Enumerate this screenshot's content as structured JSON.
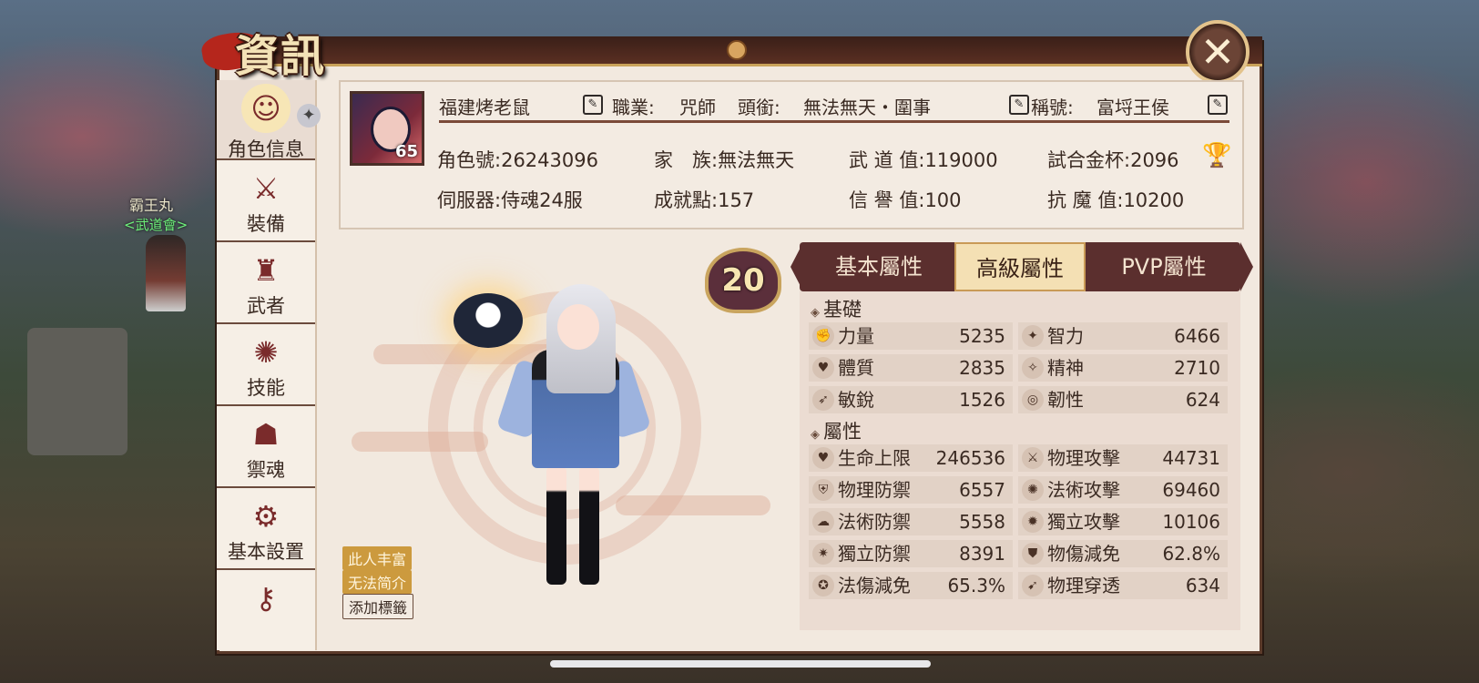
{
  "window": {
    "title": "資訊",
    "close_label": "✕"
  },
  "world": {
    "npc_name": "霸王丸",
    "npc_guild": "<武道會>"
  },
  "sidebar": {
    "items": [
      {
        "label": "角色信息",
        "icon": "character-info-icon",
        "glyph": "☺",
        "active": true
      },
      {
        "label": "裝備",
        "icon": "equipment-swords-icon",
        "glyph": "⚔"
      },
      {
        "label": "武者",
        "icon": "samurai-helmet-icon",
        "glyph": "♜"
      },
      {
        "label": "技能",
        "icon": "skill-swirl-icon",
        "glyph": "✺"
      },
      {
        "label": "禦魂",
        "icon": "soul-mask-icon",
        "glyph": "☗"
      },
      {
        "label": "基本設置",
        "icon": "gear-icon",
        "glyph": "⚙"
      },
      {
        "label": "",
        "icon": "key-icon",
        "glyph": "⚷"
      }
    ]
  },
  "profile": {
    "avatar_level": "65",
    "name": "福建烤老鼠",
    "class_label": "職業:",
    "class_value": "咒師",
    "rank_label": "頭銜:",
    "rank_value": "無法無天・圍事",
    "title_label": "稱號:",
    "title_value": "富埒王侯",
    "stats": [
      {
        "label": "角色號:",
        "value": "26243096"
      },
      {
        "label": "家　族:",
        "value": "無法無天"
      },
      {
        "label": "武 道 值:",
        "value": "119000"
      },
      {
        "label": "試合金杯:",
        "value": "2096"
      },
      {
        "label": "伺服器:",
        "value": "侍魂24服"
      },
      {
        "label": "成就點:",
        "value": "157"
      },
      {
        "label": "信 譽 值:",
        "value": "100"
      },
      {
        "label": "抗 魔 值:",
        "value": "10200"
      }
    ]
  },
  "character": {
    "badge_level": "20",
    "tags": [
      "此人丰富",
      "无法简介"
    ],
    "add_tag_label": "添加標籤"
  },
  "attributes": {
    "tabs": [
      "基本屬性",
      "高級屬性",
      "PVP屬性"
    ],
    "active_tab": 1,
    "sections": [
      {
        "title": "基礎",
        "rows": [
          [
            {
              "label": "力量",
              "value": "5235"
            },
            {
              "label": "智力",
              "value": "6466"
            }
          ],
          [
            {
              "label": "體質",
              "value": "2835"
            },
            {
              "label": "精神",
              "value": "2710"
            }
          ],
          [
            {
              "label": "敏銳",
              "value": "1526"
            },
            {
              "label": "韌性",
              "value": "624"
            }
          ]
        ]
      },
      {
        "title": "屬性",
        "rows": [
          [
            {
              "label": "生命上限",
              "value": "246536"
            },
            {
              "label": "物理攻擊",
              "value": "44731"
            }
          ],
          [
            {
              "label": "物理防禦",
              "value": "6557"
            },
            {
              "label": "法術攻擊",
              "value": "69460"
            }
          ],
          [
            {
              "label": "法術防禦",
              "value": "5558"
            },
            {
              "label": "獨立攻擊",
              "value": "10106"
            }
          ],
          [
            {
              "label": "獨立防禦",
              "value": "8391"
            },
            {
              "label": "物傷減免",
              "value": "62.8%"
            }
          ],
          [
            {
              "label": "法傷減免",
              "value": "65.3%"
            },
            {
              "label": "物理穿透",
              "value": "634"
            }
          ]
        ]
      }
    ]
  },
  "colors": {
    "accent": "#5b2f2e",
    "gold": "#c99a56",
    "panel": "#f2e9df"
  }
}
